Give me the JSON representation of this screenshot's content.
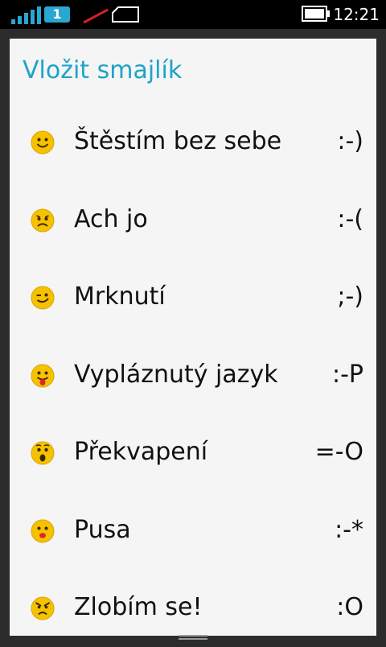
{
  "status": {
    "sim_number": "1",
    "time": "12:21"
  },
  "dialog": {
    "title": "Vložit smajlík",
    "items": [
      {
        "label": "Štěstím bez sebe",
        "code": ":-)",
        "icon": "smile-emoji-icon"
      },
      {
        "label": "Ach jo",
        "code": ":-(",
        "icon": "sad-emoji-icon"
      },
      {
        "label": "Mrknutí",
        "code": ";-)",
        "icon": "wink-emoji-icon"
      },
      {
        "label": "Vypláznutý jazyk",
        "code": ":-P",
        "icon": "tongue-emoji-icon"
      },
      {
        "label": "Překvapení",
        "code": "=-O",
        "icon": "surprised-emoji-icon"
      },
      {
        "label": "Pusa",
        "code": ":-*",
        "icon": "kiss-emoji-icon"
      },
      {
        "label": "Zlobím se!",
        "code": ":O",
        "icon": "angry-emoji-icon"
      }
    ]
  },
  "colors": {
    "accent": "#1ea3c9",
    "emoji_yellow": "#f6c200",
    "dialog_bg": "#f5f5f5"
  }
}
